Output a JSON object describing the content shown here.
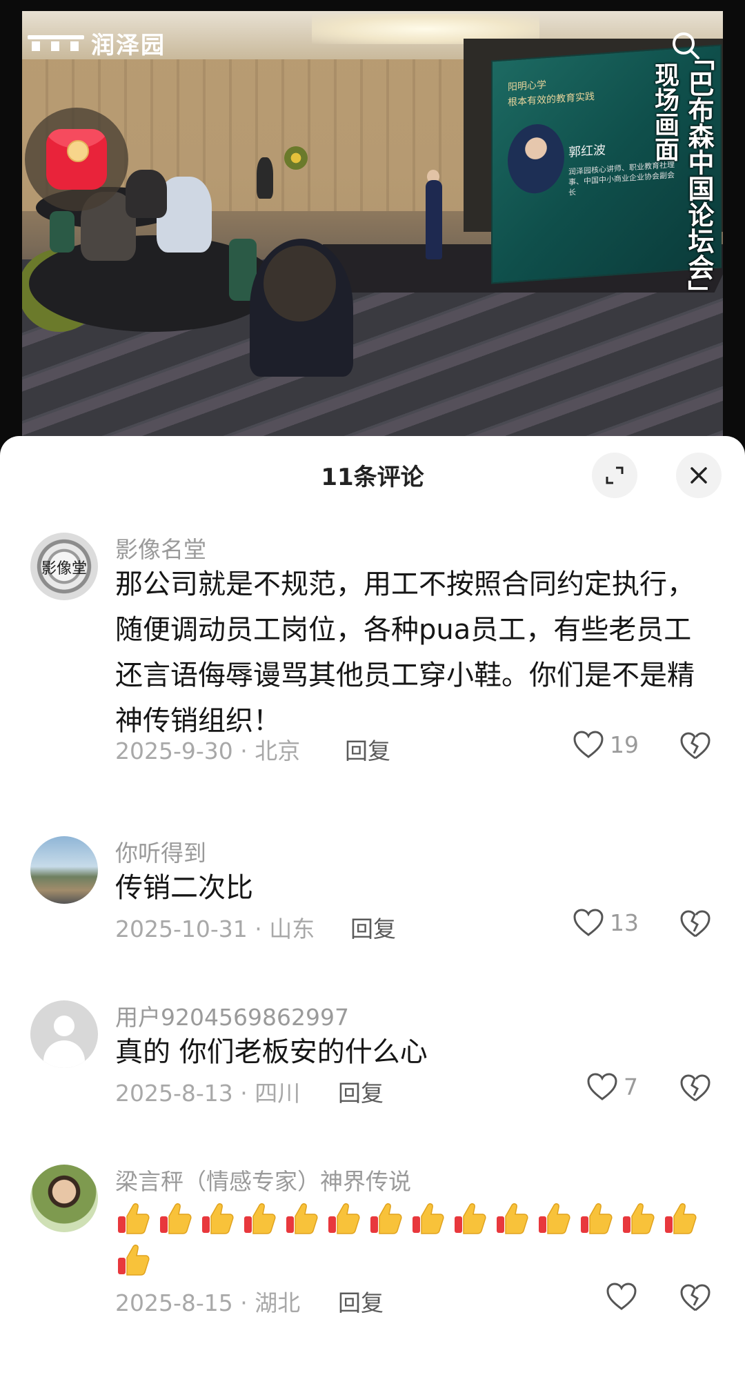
{
  "video": {
    "logo_text": "润泽园",
    "caption_vertical_1": "「巴布森中国论坛会」",
    "caption_vertical_2": "现场画面",
    "screen_heading_1": "阳明心学",
    "screen_heading_2": "根本有效的教育实践",
    "screen_name": "郭红波",
    "screen_desc": "润泽园核心讲师、职业教育社理事、中国中小商业企业协会副会长"
  },
  "panel": {
    "title": "11条评论",
    "expand_icon": "expand-icon",
    "close_icon": "close-icon"
  },
  "comments": [
    {
      "user": "影像名堂",
      "avatar_text": "影像堂",
      "text": "那公司就是不规范，用工不按照合同约定执行，随便调动员工岗位，各种pua员工，有些老员工还言语侮辱谩骂其他员工穿小鞋。你们是不是精神传销组织！",
      "date_loc": "2025-9-30 · 北京",
      "reply": "回复",
      "likes": "19"
    },
    {
      "user": "你听得到",
      "text": "传销二次比",
      "date_loc": "2025-10-31 · 山东",
      "reply": "回复",
      "likes": "13"
    },
    {
      "user": "用户9204569862997",
      "text": "真的 你们老板安的什么心",
      "date_loc": "2025-8-13 · 四川",
      "reply": "回复",
      "likes": "7"
    },
    {
      "user": "梁言秤（情感专家）神界传说",
      "text_emoji": "thumbs-up ×15",
      "thumbs_count": 15,
      "date_loc": "2025-8-15 · 湖北",
      "reply": "回复",
      "likes": ""
    }
  ],
  "colors": {
    "accent_red": "#e9233a",
    "meta_gray": "#a8a8a8",
    "text_dark": "#161616"
  }
}
